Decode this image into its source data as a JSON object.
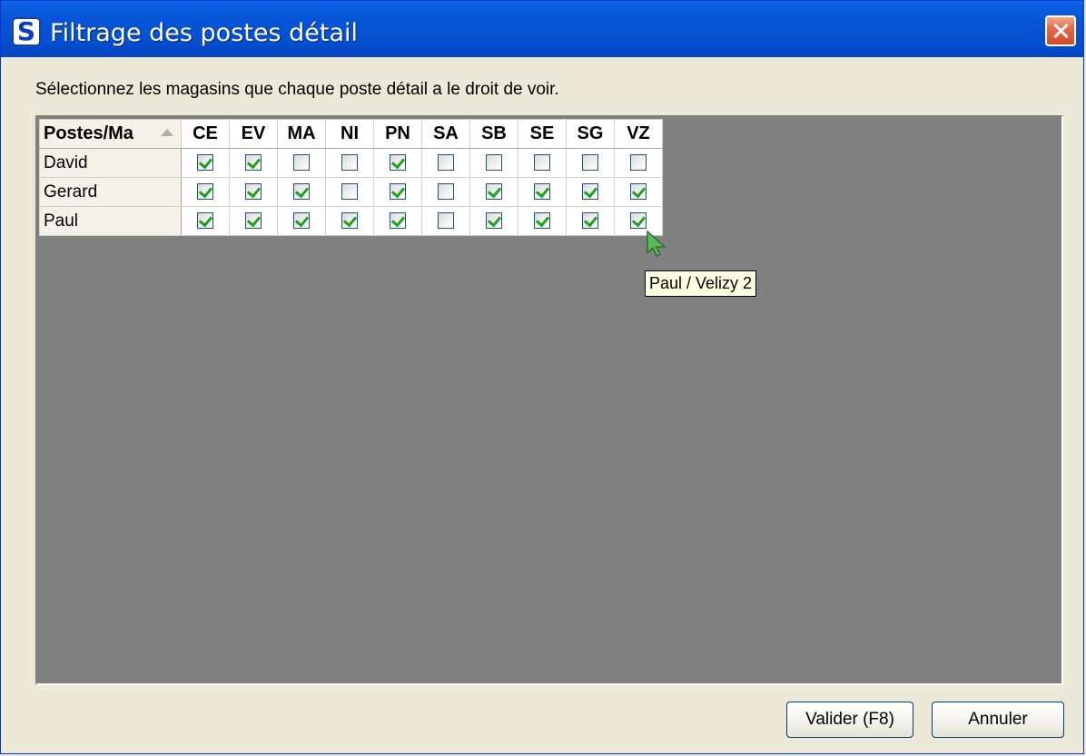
{
  "window": {
    "title": "Filtrage des postes détail",
    "icon_letter": "S"
  },
  "instruction": "Sélectionnez les magasins que chaque poste détail a le droit de voir.",
  "grid": {
    "row_header_label": "Postes/Ma",
    "columns": [
      "CE",
      "EV",
      "MA",
      "NI",
      "PN",
      "SA",
      "SB",
      "SE",
      "SG",
      "VZ"
    ],
    "rows": [
      {
        "name": "David",
        "checks": [
          true,
          true,
          false,
          false,
          true,
          false,
          false,
          false,
          false,
          false
        ]
      },
      {
        "name": "Gerard",
        "checks": [
          true,
          true,
          true,
          false,
          true,
          false,
          true,
          true,
          true,
          true
        ]
      },
      {
        "name": "Paul",
        "checks": [
          true,
          true,
          true,
          true,
          true,
          false,
          true,
          true,
          true,
          true
        ]
      }
    ]
  },
  "tooltip": "Paul / Velizy 2",
  "buttons": {
    "validate": "Valider (F8)",
    "cancel": "Annuler"
  },
  "colors": {
    "titlebar": "#0654d6",
    "grid_background": "#808080",
    "check_mark": "#21a121",
    "cursor": "#4caf50"
  }
}
